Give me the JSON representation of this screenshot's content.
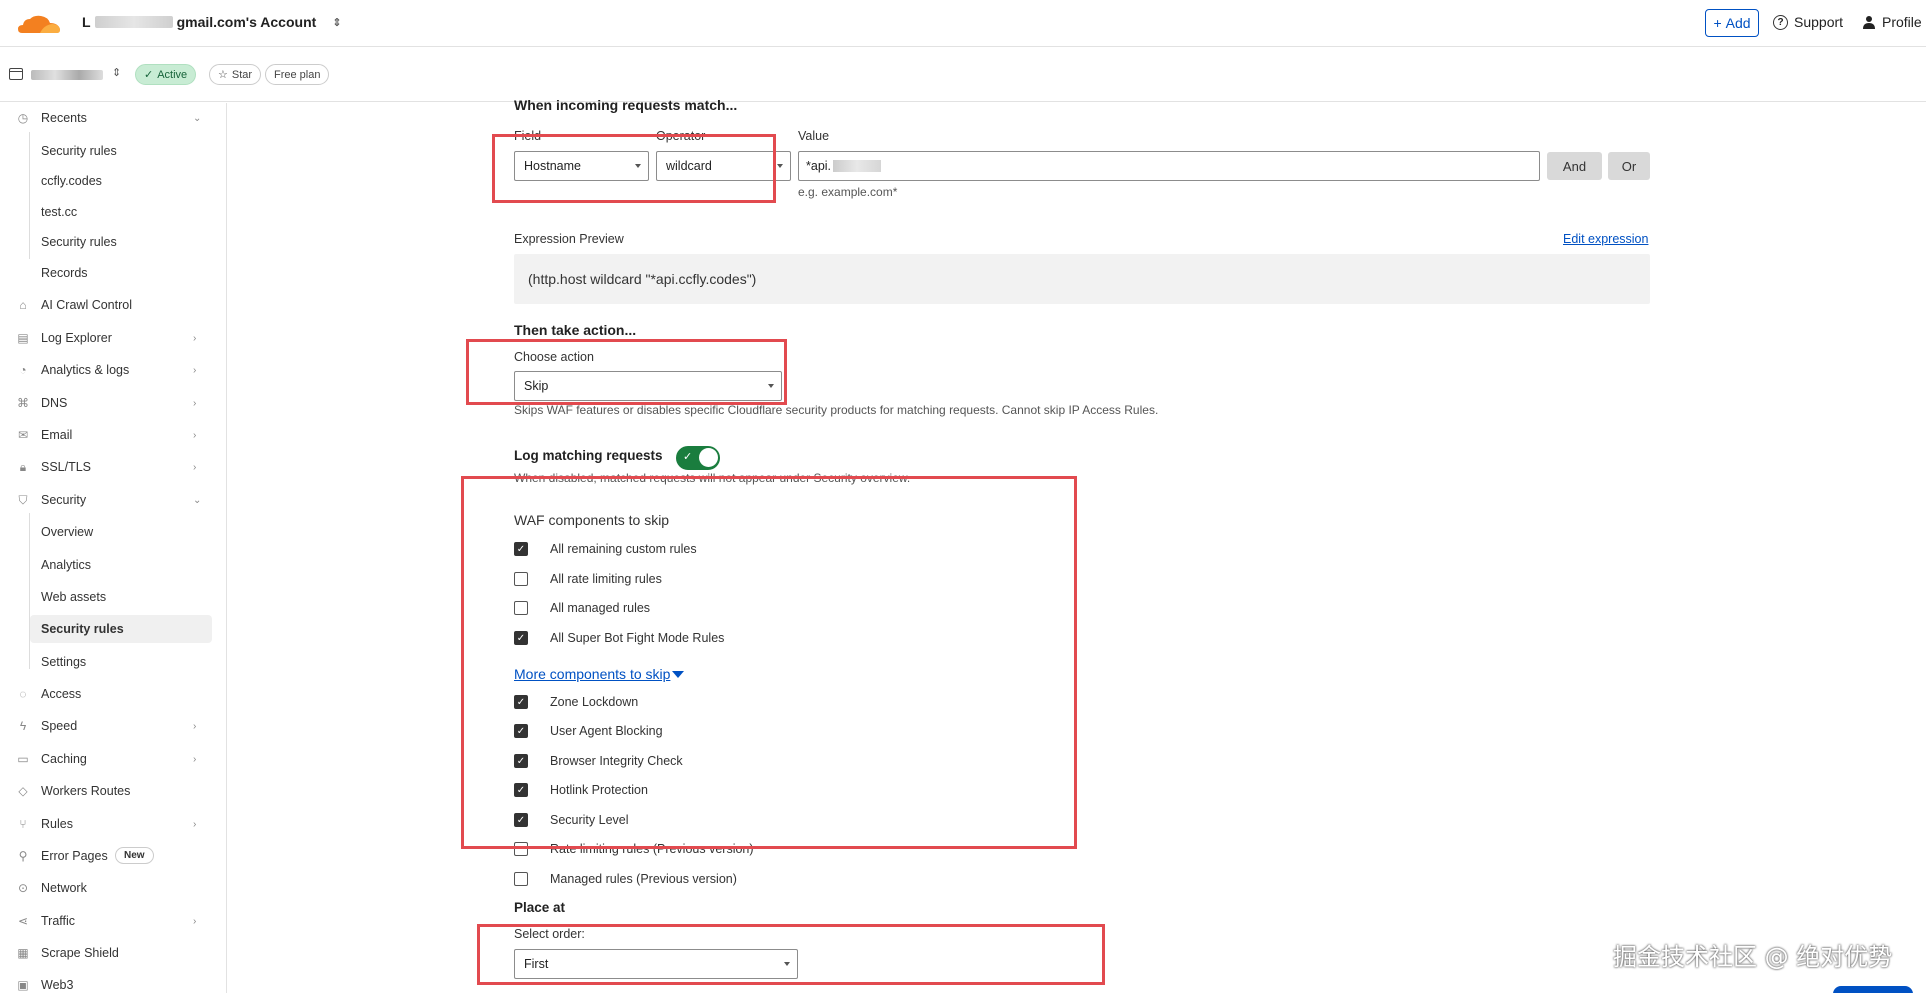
{
  "header": {
    "account_prefix": "L",
    "account_suffix": "gmail.com's Account",
    "add_label": "Add",
    "support_label": "Support",
    "profile_label": "Profile"
  },
  "zone": {
    "status_label": "Active",
    "star_label": "Star",
    "plan_label": "Free plan"
  },
  "sidebar": {
    "recents_label": "Recents",
    "recents": [
      "Security rules",
      "ccfly.codes",
      "test.cc",
      "Security rules",
      "Records"
    ],
    "items": [
      {
        "label": "AI Crawl Control",
        "icon": "crawl-icon"
      },
      {
        "label": "Log Explorer",
        "icon": "log-icon"
      },
      {
        "label": "Analytics & logs",
        "icon": "analytics-icon"
      },
      {
        "label": "DNS",
        "icon": "dns-icon"
      },
      {
        "label": "Email",
        "icon": "email-icon"
      },
      {
        "label": "SSL/TLS",
        "icon": "lock-icon"
      },
      {
        "label": "Security",
        "icon": "shield-icon"
      }
    ],
    "security_sub": [
      "Overview",
      "Analytics",
      "Web assets",
      "Security rules",
      "Settings"
    ],
    "items2": [
      {
        "label": "Access",
        "icon": "access-icon"
      },
      {
        "label": "Speed",
        "icon": "bolt-icon"
      },
      {
        "label": "Caching",
        "icon": "cache-icon"
      },
      {
        "label": "Workers Routes",
        "icon": "workers-icon"
      },
      {
        "label": "Rules",
        "icon": "rules-icon"
      },
      {
        "label": "Error Pages",
        "icon": "error-icon"
      },
      {
        "label": "Network",
        "icon": "network-icon"
      },
      {
        "label": "Traffic",
        "icon": "traffic-icon"
      },
      {
        "label": "Scrape Shield",
        "icon": "scrape-icon"
      },
      {
        "label": "Web3",
        "icon": "web3-icon"
      }
    ],
    "new_badge": "New"
  },
  "rule": {
    "match_heading": "When incoming requests match...",
    "field_label": "Field",
    "operator_label": "Operator",
    "value_label": "Value",
    "field_value": "Hostname",
    "operator_value": "wildcard",
    "value_prefix": "*api.",
    "value_hint": "e.g. example.com*",
    "and_label": "And",
    "or_label": "Or",
    "preview_label": "Expression Preview",
    "edit_expression": "Edit expression",
    "expression": "(http.host wildcard \"*api.ccfly.codes\")",
    "action_heading": "Then take action...",
    "choose_action_label": "Choose action",
    "action_value": "Skip",
    "action_hint": "Skips WAF features or disables specific Cloudflare security products for matching requests. Cannot skip IP Access Rules.",
    "log_label": "Log matching requests",
    "log_enabled": true,
    "log_hint": "When disabled, matched requests will not appear under Security overview.",
    "waf_heading": "WAF components to skip",
    "waf": [
      {
        "label": "All remaining custom rules",
        "checked": true
      },
      {
        "label": "All rate limiting rules",
        "checked": false
      },
      {
        "label": "All managed rules",
        "checked": false
      },
      {
        "label": "All Super Bot Fight Mode Rules",
        "checked": true
      }
    ],
    "more_label": "More components to skip",
    "more": [
      {
        "label": "Zone Lockdown",
        "checked": true
      },
      {
        "label": "User Agent Blocking",
        "checked": true
      },
      {
        "label": "Browser Integrity Check",
        "checked": true
      },
      {
        "label": "Hotlink Protection",
        "checked": true
      },
      {
        "label": "Security Level",
        "checked": true
      },
      {
        "label": "Rate limiting rules (Previous version)",
        "checked": false
      },
      {
        "label": "Managed rules (Previous version)",
        "checked": false
      }
    ],
    "place_heading": "Place at",
    "order_label": "Select order:",
    "order_value": "First"
  },
  "watermark": "掘金技术社区 @ 绝对优势",
  "colors": {
    "accent": "#0051c3",
    "highlight": "#e24a4f",
    "toggle_on": "#1a7d3e"
  }
}
